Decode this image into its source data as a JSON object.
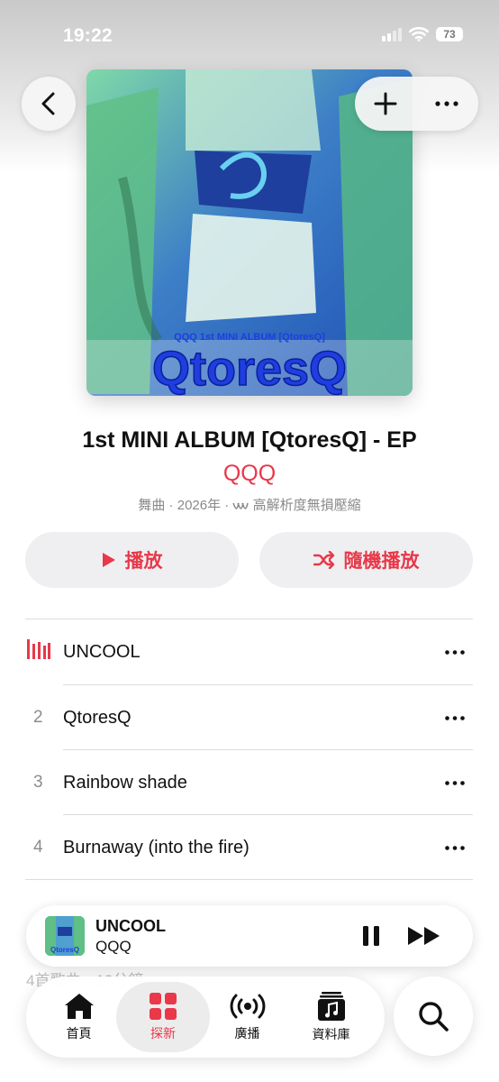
{
  "status_bar": {
    "time": "19:22",
    "battery": "73"
  },
  "album": {
    "cover_small_text": "QQQ 1st MINI ALBUM [QtoresQ]",
    "cover_logo_text": "QtoresQ",
    "title": "1st MINI ALBUM [QtoresQ] - EP",
    "artist": "QQQ",
    "meta": "舞曲 · 2026年 · ",
    "lossless_label": "高解析度無損壓縮"
  },
  "actions": {
    "play_label": "播放",
    "shuffle_label": "隨機播放"
  },
  "tracks": [
    {
      "number": "",
      "title": "UNCOOL",
      "playing": true
    },
    {
      "number": "2",
      "title": "QtoresQ",
      "playing": false
    },
    {
      "number": "3",
      "title": "Rainbow shade",
      "playing": false
    },
    {
      "number": "4",
      "title": "Burnaway (into the fire)",
      "playing": false
    }
  ],
  "footer_hint": {
    "line1": "4首歌曲，13分鐘"
  },
  "now_playing": {
    "title": "UNCOOL",
    "artist": "QQQ",
    "art_text": "QtoresQ"
  },
  "tabs": [
    {
      "label": "首頁",
      "icon": "house-icon",
      "active": false
    },
    {
      "label": "探新",
      "icon": "grid-icon",
      "active": true
    },
    {
      "label": "廣播",
      "icon": "broadcast-icon",
      "active": false
    },
    {
      "label": "資料庫",
      "icon": "library-icon",
      "active": false
    }
  ],
  "colors": {
    "accent": "#e8384a",
    "cover_logo": "#1e3ee0",
    "cover_green": "#4fc08a"
  }
}
